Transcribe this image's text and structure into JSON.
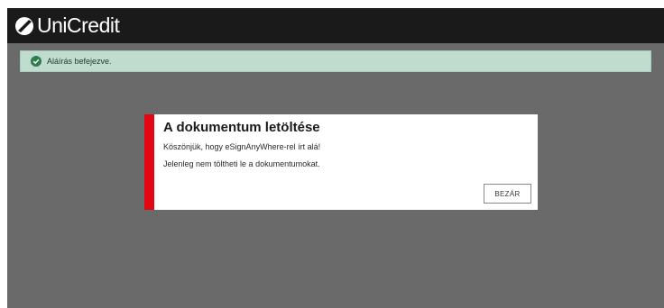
{
  "header": {
    "brand": "UniCredit",
    "logo_icon": "unicredit-logo-icon"
  },
  "alert": {
    "icon": "check-circle-icon",
    "text": "Aláírás befejezve.",
    "color": "#bfdccf"
  },
  "modal": {
    "title": "A dokumentum letöltése",
    "line1": "Köszönjük, hogy eSignAnyWhere-rel írt alá!",
    "line2": "Jelenleg nem töltheti le a dokumentumokat.",
    "close_label": "BEZÁR",
    "accent_color": "#e30613"
  },
  "colors": {
    "topbar": "#1a1a1a",
    "backdrop": "#6a6a6a"
  }
}
